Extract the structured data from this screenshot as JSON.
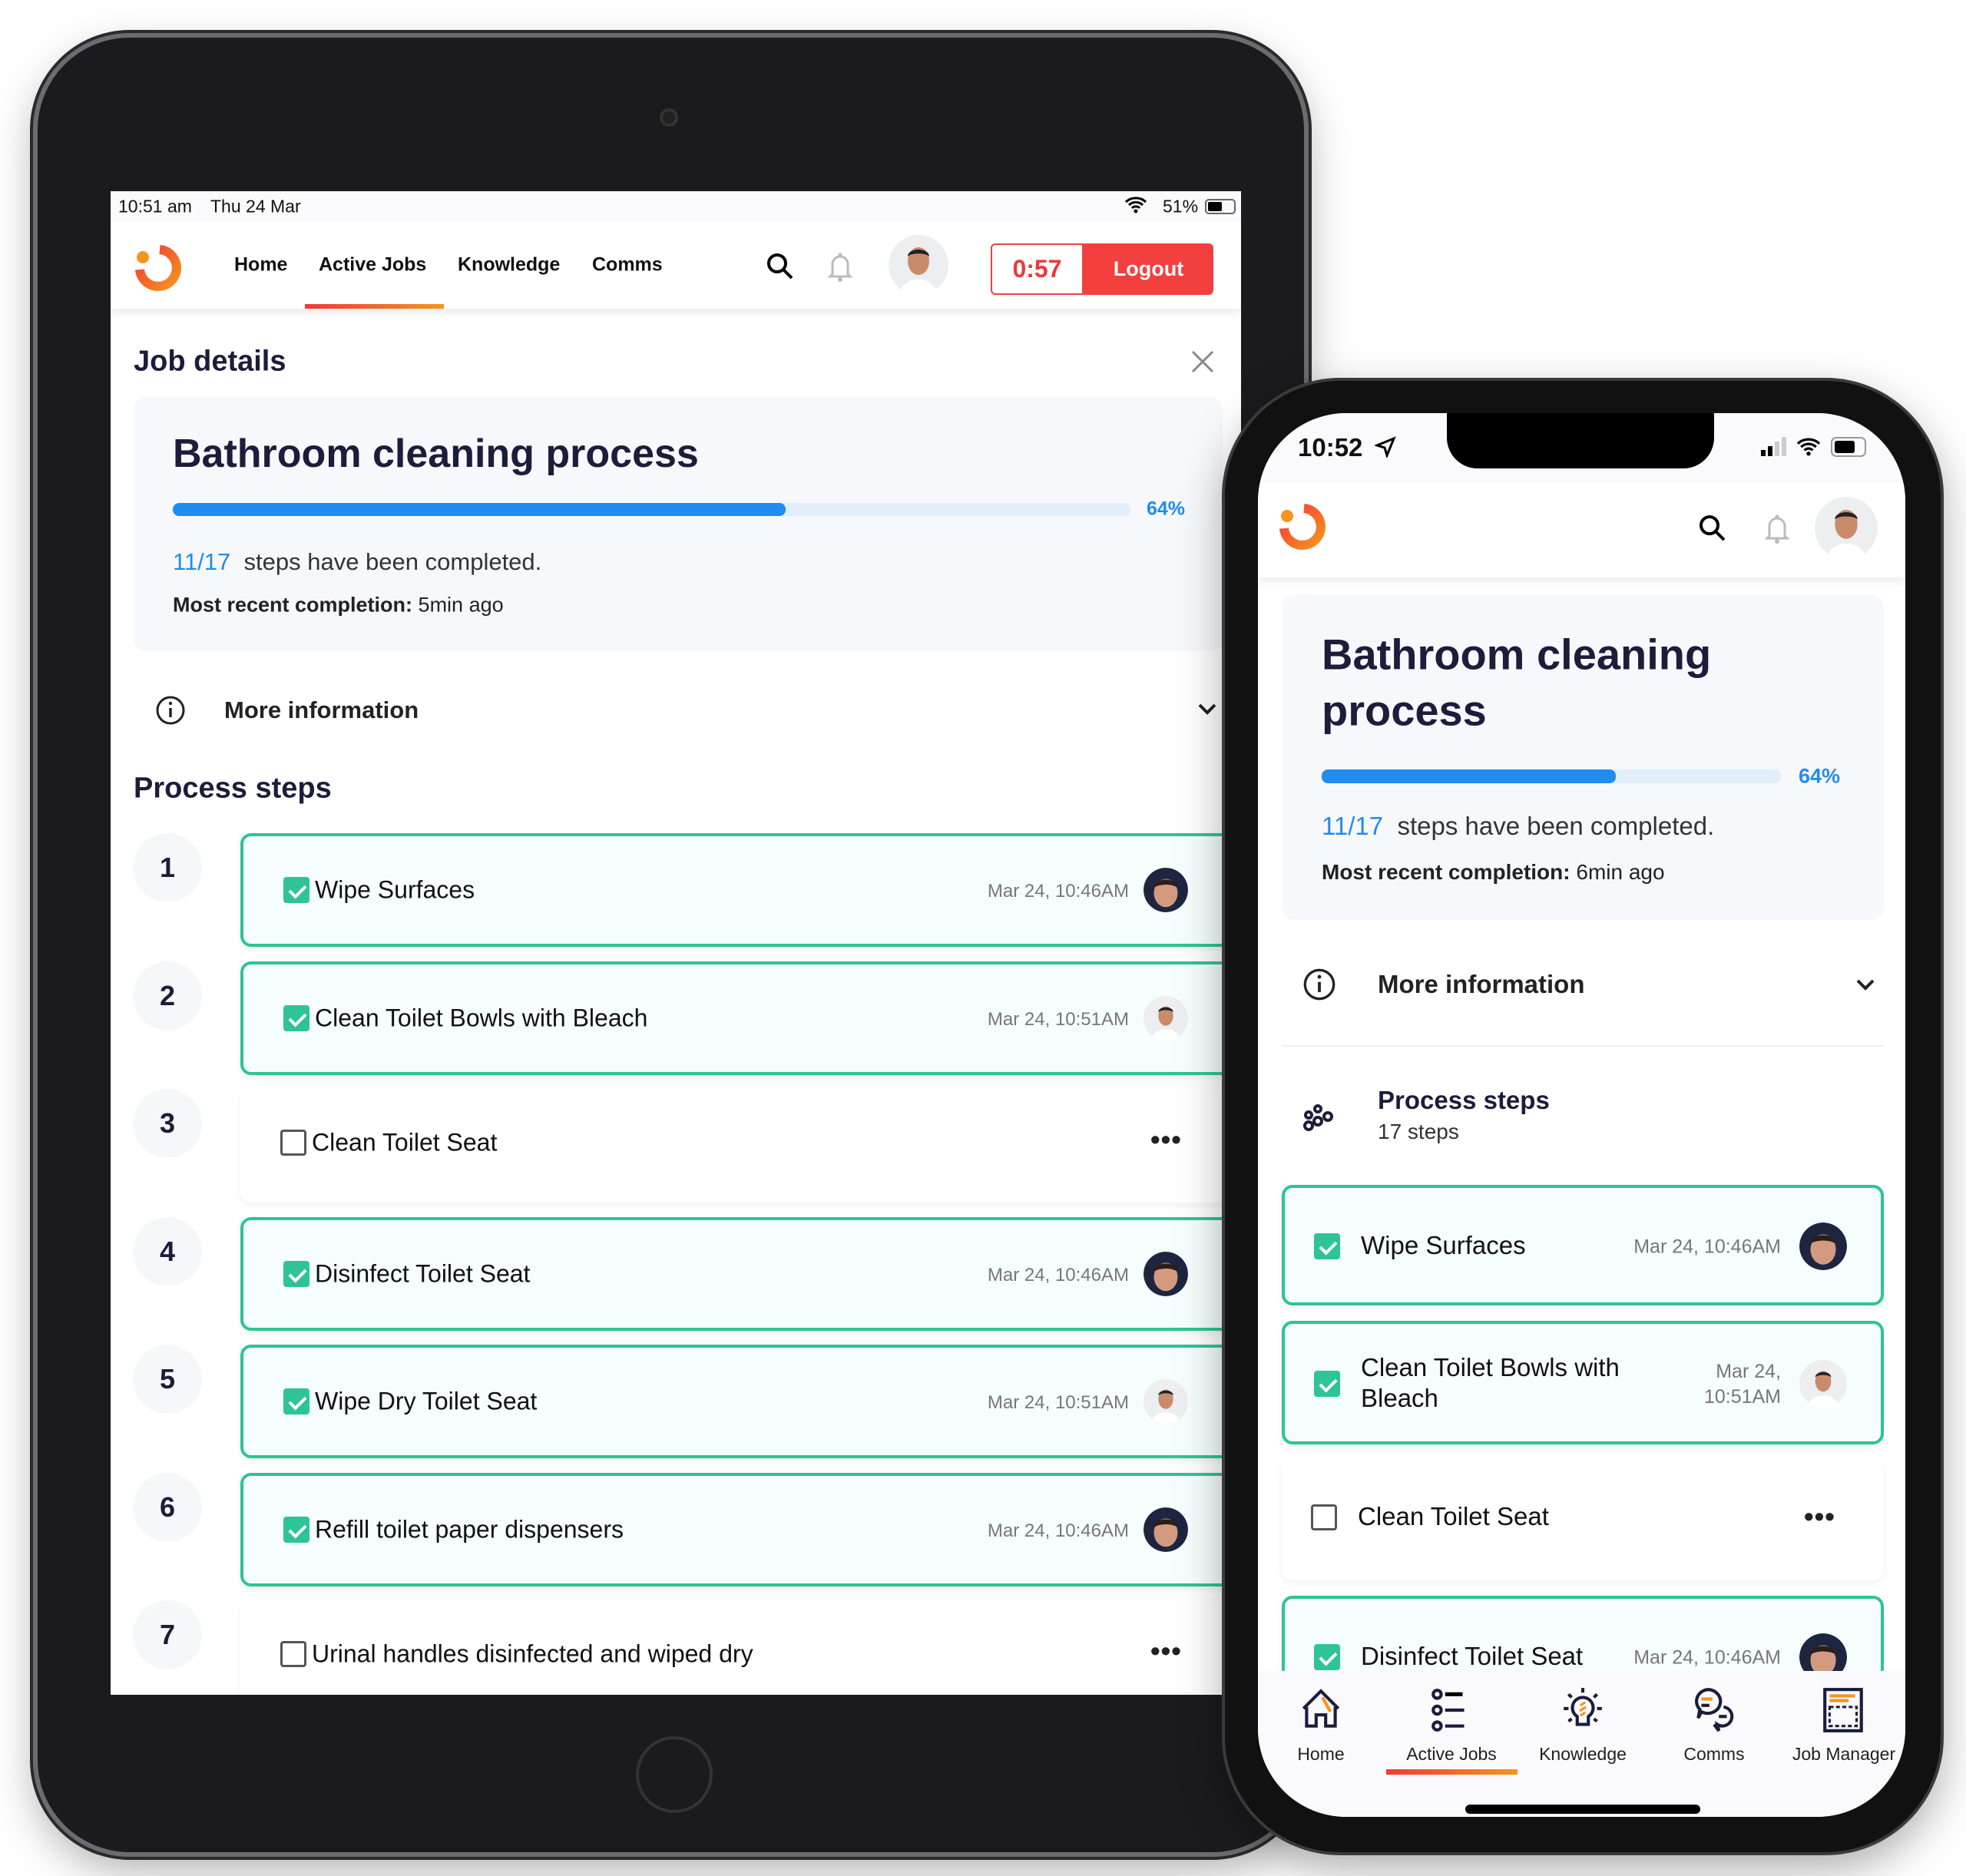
{
  "colors": {
    "accent": "#1f8cf0",
    "success": "#2ec495",
    "danger": "#f43f3f",
    "brand_gradient": [
      "#ef3b36",
      "#f7931e"
    ],
    "text_dark": "#1b1d3a"
  },
  "tablet": {
    "status": {
      "time": "10:51 am",
      "date": "Thu 24 Mar",
      "battery": "51%"
    },
    "nav": [
      {
        "label": "Home"
      },
      {
        "label": "Active Jobs",
        "active": true
      },
      {
        "label": "Knowledge"
      },
      {
        "label": "Comms"
      }
    ],
    "timer": "0:57",
    "logout": "Logout",
    "page_title": "Job details",
    "job": {
      "title": "Bathroom cleaning process",
      "progress_percent": 64,
      "progress_label": "64%",
      "steps_done": "11/17",
      "steps_text": "steps have been completed.",
      "recent_label": "Most recent completion:",
      "recent_value": "5min ago"
    },
    "more_info": "More information",
    "process_heading": "Process steps",
    "steps": [
      {
        "num": "1",
        "label": "Wipe Surfaces",
        "done": true,
        "date": "Mar 24, 10:46AM",
        "avatar": "dark"
      },
      {
        "num": "2",
        "label": "Clean Toilet Bowls with Bleach",
        "done": true,
        "date": "Mar 24, 10:51AM",
        "avatar": "light"
      },
      {
        "num": "3",
        "label": "Clean Toilet Seat",
        "done": false
      },
      {
        "num": "4",
        "label": "Disinfect Toilet Seat",
        "done": true,
        "date": "Mar 24, 10:46AM",
        "avatar": "dark"
      },
      {
        "num": "5",
        "label": "Wipe Dry Toilet Seat",
        "done": true,
        "date": "Mar 24, 10:51AM",
        "avatar": "light"
      },
      {
        "num": "6",
        "label": "Refill toilet paper dispensers",
        "done": true,
        "date": "Mar 24, 10:46AM",
        "avatar": "dark"
      },
      {
        "num": "7",
        "label": "Urinal handles disinfected and wiped dry",
        "done": false
      }
    ]
  },
  "phone": {
    "status": {
      "time": "10:52"
    },
    "job": {
      "title_line1": "Bathroom cleaning",
      "title_line2": "process",
      "progress_percent": 64,
      "progress_label": "64%",
      "steps_done": "11/17",
      "steps_text": "steps have been completed.",
      "recent_label": "Most recent completion:",
      "recent_value": "6min ago"
    },
    "more_info": "More information",
    "process": {
      "title": "Process steps",
      "subtitle": "17 steps"
    },
    "steps": [
      {
        "label": "Wipe Surfaces",
        "done": true,
        "date": "Mar 24, 10:46AM",
        "avatar": "dark"
      },
      {
        "label": "Clean Toilet Bowls with Bleach",
        "done": true,
        "date": "Mar 24, 10:51AM",
        "avatar": "light"
      },
      {
        "label": "Clean Toilet Seat",
        "done": false
      },
      {
        "label": "Disinfect Toilet Seat",
        "done": true,
        "date": "Mar 24, 10:46AM",
        "avatar": "dark"
      }
    ],
    "tabs": [
      {
        "label": "Home",
        "icon": "home-icon"
      },
      {
        "label": "Active Jobs",
        "icon": "list-icon",
        "active": true
      },
      {
        "label": "Knowledge",
        "icon": "lightbulb-icon"
      },
      {
        "label": "Comms",
        "icon": "chat-icon"
      },
      {
        "label": "Job Manager",
        "icon": "board-icon"
      }
    ]
  }
}
